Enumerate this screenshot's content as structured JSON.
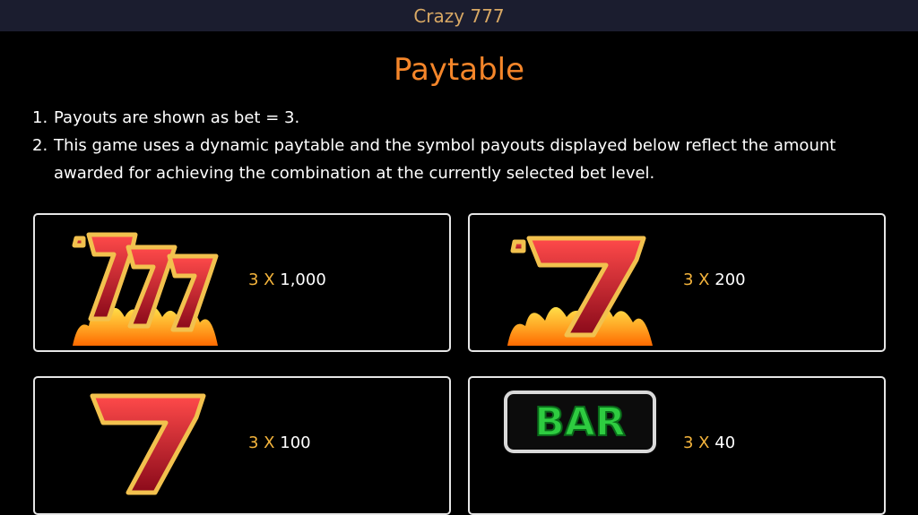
{
  "header": {
    "title": "Crazy 777"
  },
  "page": {
    "heading": "Paytable"
  },
  "rules": [
    {
      "num": "1.",
      "text": "Payouts are shown as bet = 3."
    },
    {
      "num": "2.",
      "text": "This game uses a dynamic paytable and the symbol payouts displayed below reflect the amount awarded for achieving the combination at the currently selected bet level."
    }
  ],
  "paytable": [
    {
      "symbol": "triple-seven-fire-icon",
      "multiplier": "3 X",
      "value": "1,000"
    },
    {
      "symbol": "single-seven-fire-icon",
      "multiplier": "3 X",
      "value": "200"
    },
    {
      "symbol": "seven-icon",
      "multiplier": "3 X",
      "value": "100"
    },
    {
      "symbol": "bar-icon",
      "label": "BAR",
      "multiplier": "3 X",
      "value": "40"
    }
  ],
  "colors": {
    "header_bg": "#1b1d2f",
    "header_text": "#d8a864",
    "heading": "#f5862a",
    "multiplier": "#f4b43c",
    "card_border": "#e6e6e6",
    "seven_red": "#c8102e",
    "seven_gold": "#f2c14e",
    "bar_green": "#2ecc40"
  }
}
